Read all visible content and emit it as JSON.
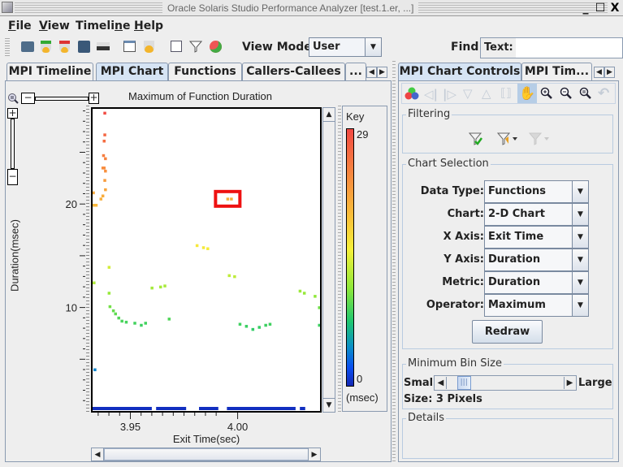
{
  "window": {
    "title": "Oracle Solaris Studio Performance Analyzer [test.1.er, ...]",
    "minimize": "_",
    "maximize": "☐",
    "close": "X"
  },
  "menubar": [
    {
      "label": "File",
      "mnemonic": "F",
      "rest": "ile"
    },
    {
      "label": "View",
      "mnemonic": "V",
      "rest": "iew"
    },
    {
      "label": "Timeline",
      "pre": "Timeli",
      "mnemonic": "n",
      "rest": "e"
    },
    {
      "label": "Help",
      "mnemonic": "H",
      "rest": "elp"
    }
  ],
  "toolbar": {
    "icons": [
      "open-experiment-icon",
      "add-experiment-icon",
      "drop-experiment-icon",
      "save-icon",
      "print-icon",
      "new-window-icon",
      "close-window-icon",
      "settings-icon",
      "filter-icon",
      "show-hide-icon"
    ],
    "view_mode_label": "View Mode",
    "view_mode_value": "User",
    "find_label": "Find",
    "find_text_label": "Text:",
    "find_text_value": ""
  },
  "left_tabs": [
    {
      "label": "MPI Timeline",
      "selected": false
    },
    {
      "label": "MPI Chart",
      "selected": true
    },
    {
      "label": "Functions",
      "selected": false
    },
    {
      "label": "Callers-Callees",
      "selected": false
    },
    {
      "label": "...",
      "selected": false
    }
  ],
  "right_tabs": [
    {
      "label": "MPI Chart Controls",
      "selected": true
    },
    {
      "label": "MPI Tim...",
      "selected": false
    }
  ],
  "controls": {
    "toolbar_icons": [
      "colors-icon",
      "back-icon",
      "forward-icon",
      "down-icon",
      "up-icon",
      "reset-icon",
      "pan-icon",
      "zoom-in-icon",
      "zoom-out-icon",
      "zoom-reset-icon",
      "undo-icon"
    ],
    "filtering_label": "Filtering",
    "chart_selection_label": "Chart Selection",
    "fields": [
      {
        "label": "Data Type:",
        "value": "Functions"
      },
      {
        "label": "Chart:",
        "value": "2-D Chart"
      },
      {
        "label": "X Axis:",
        "value": "Exit Time"
      },
      {
        "label": "Y Axis:",
        "value": "Duration"
      },
      {
        "label": "Metric:",
        "value": "Duration"
      },
      {
        "label": "Operator:",
        "value": "Maximum"
      }
    ],
    "redraw_label": "Redraw",
    "min_bin_label": "Minimum Bin Size",
    "small_label": "Small",
    "large_label": "Large",
    "size_text": "Size: 3 Pixels",
    "bin_size_fraction": 0.1,
    "details_label": "Details"
  },
  "chart_data": {
    "type": "heatmap",
    "title": "Maximum of Function Duration",
    "xlabel": "Exit Time(sec)",
    "ylabel": "Duration(msec)",
    "x_ticks": [
      3.95,
      4.0
    ],
    "x_tick_labels": [
      "3.95",
      "4.00"
    ],
    "y_ticks": [
      10,
      20
    ],
    "y_tick_labels": [
      "10",
      "20"
    ],
    "xlim": [
      3.9324,
      4.0384
    ],
    "ylim": [
      0,
      29.2
    ],
    "key": {
      "title": "Key",
      "max": "29",
      "min": "0",
      "unit": "(msec)",
      "range": [
        0,
        29
      ]
    },
    "highlight": {
      "x": 3.995,
      "y": 20.5
    },
    "points": [
      {
        "x": 3.938,
        "y": 28.8
      },
      {
        "x": 3.938,
        "y": 26.7
      },
      {
        "x": 3.9377,
        "y": 26.1
      },
      {
        "x": 3.9374,
        "y": 24.7
      },
      {
        "x": 3.9383,
        "y": 24.4
      },
      {
        "x": 3.9371,
        "y": 23.5
      },
      {
        "x": 3.9377,
        "y": 23.5
      },
      {
        "x": 3.9383,
        "y": 23.2
      },
      {
        "x": 3.938,
        "y": 22.3
      },
      {
        "x": 3.9383,
        "y": 21.4
      },
      {
        "x": 3.9327,
        "y": 21.1
      },
      {
        "x": 3.9371,
        "y": 20.8
      },
      {
        "x": 3.9362,
        "y": 20.5
      },
      {
        "x": 3.933,
        "y": 19.9
      },
      {
        "x": 3.934,
        "y": 19.9
      },
      {
        "x": 3.9953,
        "y": 20.5
      },
      {
        "x": 3.997,
        "y": 20.5
      },
      {
        "x": 3.981,
        "y": 16.0
      },
      {
        "x": 3.984,
        "y": 15.8
      },
      {
        "x": 3.986,
        "y": 15.7
      },
      {
        "x": 3.94,
        "y": 13.9
      },
      {
        "x": 3.933,
        "y": 12.4
      },
      {
        "x": 3.94,
        "y": 11.4
      },
      {
        "x": 3.9404,
        "y": 10.1
      },
      {
        "x": 3.942,
        "y": 9.7
      },
      {
        "x": 3.943,
        "y": 9.4
      },
      {
        "x": 3.9445,
        "y": 9.0
      },
      {
        "x": 3.946,
        "y": 8.7
      },
      {
        "x": 3.948,
        "y": 8.6
      },
      {
        "x": 3.952,
        "y": 8.5
      },
      {
        "x": 3.955,
        "y": 8.3
      },
      {
        "x": 3.957,
        "y": 8.5
      },
      {
        "x": 3.96,
        "y": 11.9
      },
      {
        "x": 3.964,
        "y": 12.0
      },
      {
        "x": 3.966,
        "y": 12.1
      },
      {
        "x": 3.968,
        "y": 8.9
      },
      {
        "x": 3.996,
        "y": 13.1
      },
      {
        "x": 3.9985,
        "y": 13.0
      },
      {
        "x": 4.001,
        "y": 8.4
      },
      {
        "x": 4.004,
        "y": 8.2
      },
      {
        "x": 4.007,
        "y": 7.9
      },
      {
        "x": 4.01,
        "y": 8.1
      },
      {
        "x": 4.013,
        "y": 8.3
      },
      {
        "x": 4.015,
        "y": 8.4
      },
      {
        "x": 4.029,
        "y": 11.6
      },
      {
        "x": 4.031,
        "y": 11.4
      },
      {
        "x": 4.036,
        "y": 11.1
      },
      {
        "x": 4.038,
        "y": 10.0
      },
      {
        "x": 4.038,
        "y": 8.3
      },
      {
        "x": 3.9334,
        "y": 4.0
      }
    ],
    "baseline_segments": [
      [
        3.9324,
        3.96
      ],
      [
        3.962,
        3.976
      ],
      [
        3.982,
        3.991
      ],
      [
        3.995,
        4.027
      ],
      [
        4.029,
        4.0315
      ]
    ],
    "baseline_value": 0.4
  }
}
